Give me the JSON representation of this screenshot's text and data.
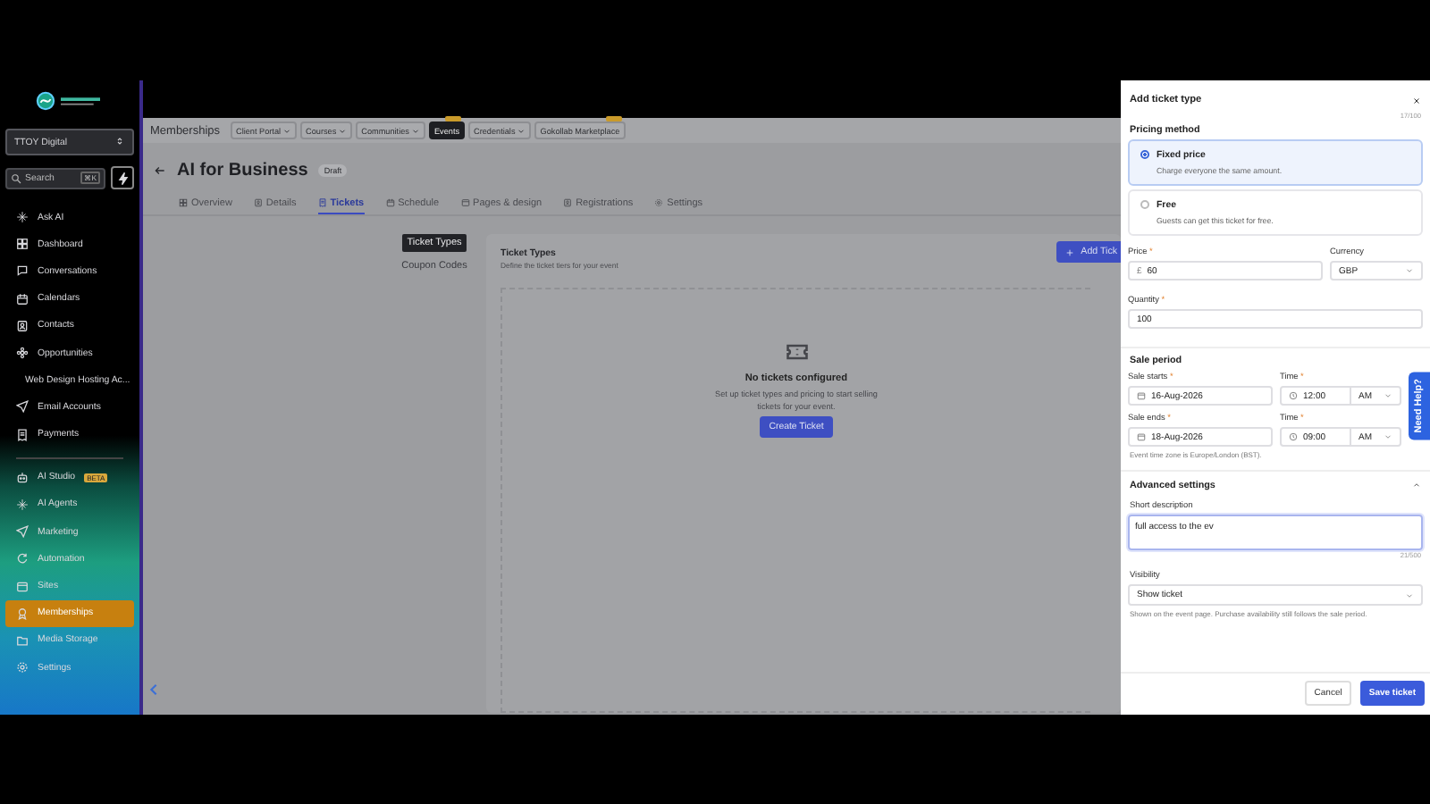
{
  "sidebar": {
    "workspace": "TTOY Digital",
    "search": {
      "placeholder": "Search",
      "shortcut": "⌘K"
    },
    "items": [
      {
        "label": "Ask AI",
        "selected": false
      },
      {
        "label": "Dashboard",
        "selected": false
      },
      {
        "label": "Conversations",
        "selected": false
      },
      {
        "label": "Calendars",
        "selected": false
      },
      {
        "label": "Contacts",
        "selected": false
      },
      {
        "label": "Opportunities",
        "selected": false
      },
      {
        "label": "Web Design Hosting Ac...",
        "selected": false
      },
      {
        "label": "Email Accounts",
        "selected": false
      },
      {
        "label": "Payments",
        "selected": false
      }
    ],
    "lower_items": [
      {
        "label": "AI Studio",
        "selected": false,
        "badge": "BETA"
      },
      {
        "label": "AI Agents",
        "selected": false
      },
      {
        "label": "Marketing",
        "selected": false
      },
      {
        "label": "Automation",
        "selected": false
      },
      {
        "label": "Sites",
        "selected": false
      },
      {
        "label": "Memberships",
        "selected": true
      },
      {
        "label": "Media Storage",
        "selected": false
      },
      {
        "label": "Settings",
        "selected": false
      }
    ]
  },
  "top_nav": {
    "title": "Memberships",
    "items": [
      {
        "label": "Client Portal",
        "dropdown": true,
        "selected": false,
        "tagged": false
      },
      {
        "label": "Courses",
        "dropdown": true,
        "selected": false,
        "tagged": false
      },
      {
        "label": "Communities",
        "dropdown": true,
        "selected": false,
        "tagged": false
      },
      {
        "label": "Events",
        "dropdown": false,
        "selected": true,
        "tagged": true
      },
      {
        "label": "Credentials",
        "dropdown": true,
        "selected": false,
        "tagged": false
      },
      {
        "label": "Gokollab Marketplace",
        "dropdown": false,
        "selected": false,
        "tagged": true
      }
    ]
  },
  "page": {
    "title": "AI for Business",
    "status": "Draft",
    "tabs": [
      {
        "label": "Overview",
        "selected": false
      },
      {
        "label": "Details",
        "selected": false
      },
      {
        "label": "Tickets",
        "selected": true
      },
      {
        "label": "Schedule",
        "selected": false
      },
      {
        "label": "Pages & design",
        "selected": false
      },
      {
        "label": "Registrations",
        "selected": false
      },
      {
        "label": "Settings",
        "selected": false
      }
    ],
    "subnav": [
      {
        "label": "Ticket Types",
        "selected": true
      },
      {
        "label": "Coupon Codes",
        "selected": false
      }
    ],
    "card": {
      "title": "Ticket Types",
      "subtitle": "Define the ticket tiers for your event",
      "add_button": "Add Tick",
      "empty_title": "No tickets configured",
      "empty_text": "Set up ticket types and pricing to start selling tickets for your event.",
      "create_button": "Create Ticket"
    }
  },
  "panel": {
    "title": "Add ticket type",
    "required_mark": "*",
    "name_counter": "17/100",
    "pricing_label": "Pricing method",
    "options": [
      {
        "label": "Fixed price",
        "description": "Charge everyone the same amount.",
        "selected": true
      },
      {
        "label": "Free",
        "description": "Guests can get this ticket for free.",
        "selected": false
      }
    ],
    "price": {
      "label": "Price",
      "required": true,
      "symbol": "£",
      "value": "60"
    },
    "currency": {
      "label": "Currency",
      "value": "GBP"
    },
    "quantity": {
      "label": "Quantity",
      "required": true,
      "value": "100"
    },
    "sale_period": "Sale period",
    "sale_rows": [
      {
        "date_label": "Sale starts",
        "date": "16-Aug-2026",
        "time_label": "Time",
        "time": "12:00",
        "ampm": "AM"
      },
      {
        "date_label": "Sale ends",
        "date": "18-Aug-2026",
        "time_label": "Time",
        "time": "09:00",
        "ampm": "AM"
      }
    ],
    "timezone_note": "Event time zone is Europe/London (BST).",
    "advanced": {
      "label": "Advanced settings",
      "expanded": true
    },
    "description": {
      "label": "Short description",
      "value": "full access to the ev",
      "counter": "21/500"
    },
    "visibility": {
      "label": "Visibility",
      "value": "Show ticket",
      "hint": "Shown on the event page. Purchase availability still follows the sale period."
    },
    "buttons": {
      "cancel": "Cancel",
      "save": "Save ticket"
    }
  },
  "help_tab": "Need Help?"
}
